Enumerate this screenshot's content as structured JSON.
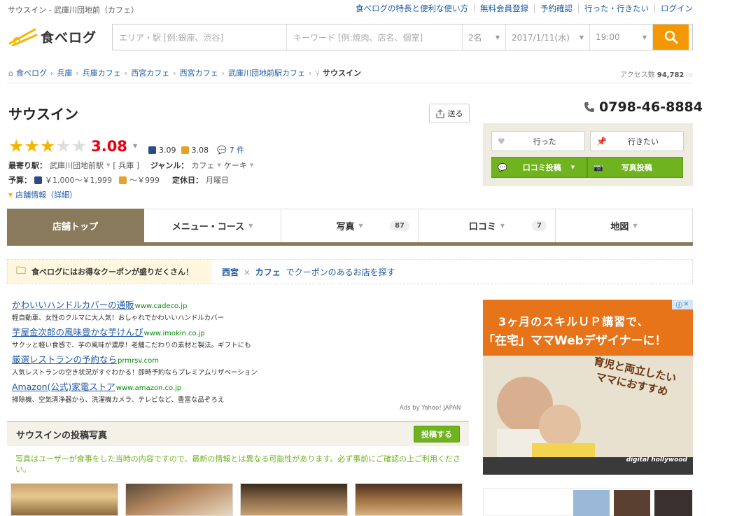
{
  "header": {
    "page_title": "サウスイン - 武庫川団地前（カフェ）",
    "links": [
      "食べログの特長と便利な使い方",
      "無料会員登録",
      "予約確認",
      "行った・行きたい",
      "ログイン"
    ],
    "logo_text": "食べログ"
  },
  "search": {
    "area_placeholder": "エリア・駅 [例:銀座、渋谷]",
    "keyword_placeholder": "キーワード [例:焼肉、店名、個室]",
    "people": "2名",
    "date": "2017/1/11(水)",
    "time": "19:00",
    "button_icon": "search-icon"
  },
  "breadcrumb": {
    "items": [
      "食べログ",
      "兵庫",
      "兵庫カフェ",
      "西宮カフェ",
      "西宮カフェ",
      "武庫川団地前駅カフェ"
    ],
    "current": "サウスイン",
    "access_label": "アクセス数",
    "access_count": "94,782"
  },
  "shop": {
    "name": "サウスイン",
    "send_label": "送る",
    "rating": 3.08,
    "rating_text": "3.08",
    "stars_on": 3,
    "stars_total": 5,
    "night_score": "3.09",
    "lunch_score": "3.08",
    "review_count": "7 件",
    "nearest_label": "最寄り駅：",
    "station": "武庫川団地前駅",
    "station_pref": "[ 兵庫 ]",
    "genre_label": "ジャンル：",
    "genre1": "カフェ",
    "genre2": "ケーキ",
    "budget_label": "予算：",
    "budget_night": "￥1,000～￥1,999",
    "budget_lunch": "～￥999",
    "holiday_label": "定休日：",
    "holiday": "月曜日",
    "info_link": "店舗情報（詳細）",
    "phone": "0798-46-8884"
  },
  "actions": {
    "went": "行った",
    "want": "行きたい",
    "review_post": "口コミ投稿",
    "photo_post": "写真投稿"
  },
  "tabs": [
    {
      "label": "店舗トップ",
      "count": ""
    },
    {
      "label": "メニュー・コース",
      "count": ""
    },
    {
      "label": "写真",
      "count": "87"
    },
    {
      "label": "口コミ",
      "count": "7"
    },
    {
      "label": "地図",
      "count": ""
    }
  ],
  "coupon": {
    "left_text": "食べログにはお得なクーポンが盛りだくさん！",
    "area": "西宮",
    "times": "×",
    "genre": "カフェ",
    "suffix": "でクーポンのあるお店を探す"
  },
  "ads": [
    {
      "title": "かわいいハンドルカバーの通販",
      "url": "www.cadeco.jp",
      "desc": "軽自動車、女性のクルマに大人気！おしゃれでかわいいハンドルカバー"
    },
    {
      "title": "芋屋金次郎の風味豊かな芋けんぴ",
      "url": "www.imokin.co.jp",
      "desc": "サクッと軽い食感で、芋の風味が濃厚！老舗こだわりの素材と製法。ギフトにも"
    },
    {
      "title": "厳選レストランの予約なら",
      "url": "prmrsv.com",
      "desc": "人気レストランの空き状況がすぐわかる！即時予約ならプレミアムリザベーション"
    },
    {
      "title": "Amazon(公式)家電ストア",
      "url": "www.amazon.co.jp",
      "desc": "掃除機、空気清浄器から、洗濯機カメラ、テレビなど、豊富な品ぞろえ"
    }
  ],
  "ads_by": "Ads by Yahoo! JAPAN",
  "photos": {
    "title": "サウスインの投稿写真",
    "post_button": "投稿する",
    "note": "写真はユーザーが食事をした当時の内容ですので、最新の情報とは異なる可能性があります。必ず事前にご確認の上ご利用ください。"
  },
  "banner": {
    "line1": "3ヶ月のスキルＵＰ講習で、",
    "line2": "「在宅」ママWebデザイナーに！",
    "line3": "育児と両立したいママにおすすめ",
    "brand": "digital hollywood"
  },
  "colors": {
    "accent": "#f39800",
    "score_red": "#e60012",
    "star": "#f3b600",
    "green": "#6fb41e",
    "tab_active": "#8a7a5c",
    "link": "#1e5aa8"
  }
}
